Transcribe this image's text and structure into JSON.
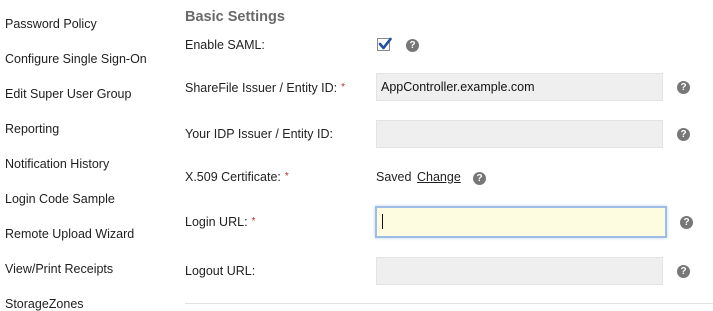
{
  "sidebar": {
    "items": [
      {
        "label": "Password Policy"
      },
      {
        "label": "Configure Single Sign-On"
      },
      {
        "label": "Edit Super User Group"
      },
      {
        "label": "Reporting"
      },
      {
        "label": "Notification History"
      },
      {
        "label": "Login Code Sample"
      },
      {
        "label": "Remote Upload Wizard"
      },
      {
        "label": "View/Print Receipts"
      },
      {
        "label": "StorageZones"
      }
    ]
  },
  "section": {
    "title": "Basic Settings"
  },
  "form": {
    "required_marker": "*",
    "help_glyph": "?",
    "enable_saml": {
      "label": "Enable SAML:",
      "checked": true
    },
    "issuer": {
      "label": "ShareFile Issuer / Entity ID:",
      "value": "AppController.example.com",
      "required": true
    },
    "idp_issuer": {
      "label": "Your IDP Issuer / Entity ID:",
      "value": ""
    },
    "certificate": {
      "label": "X.509 Certificate:",
      "status": "Saved",
      "change_label": "Change",
      "required": true
    },
    "login_url": {
      "label": "Login URL:",
      "value": "",
      "required": true,
      "focused": true
    },
    "logout_url": {
      "label": "Logout URL:",
      "value": ""
    }
  },
  "colors": {
    "help_icon": "#777777",
    "required": "#c0282d",
    "focus_border": "#9dbde5",
    "focus_bg": "#fdfbe0",
    "field_bg": "#efefef"
  }
}
